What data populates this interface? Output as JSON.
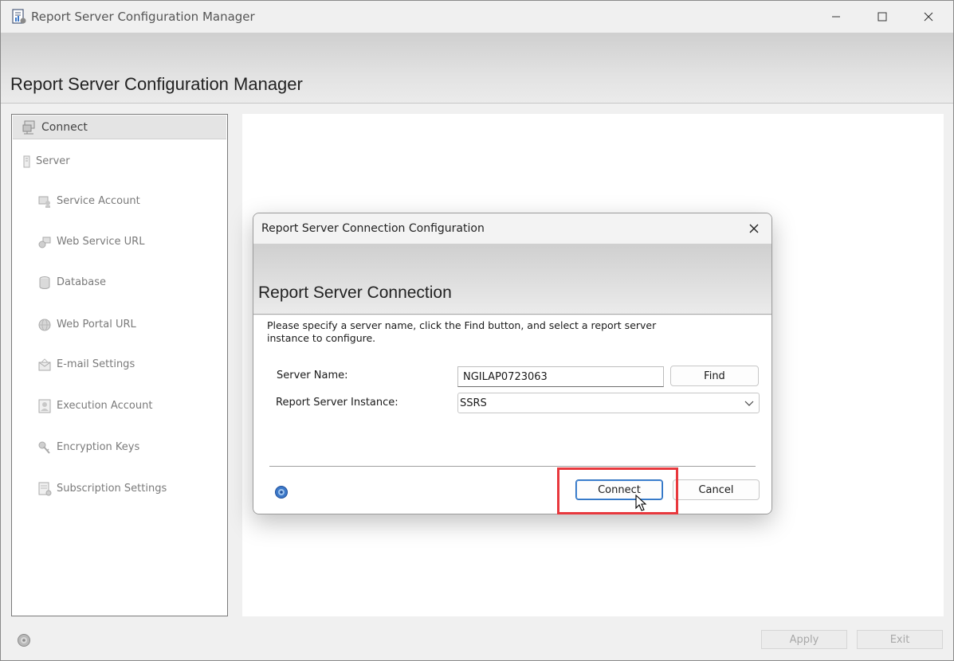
{
  "window": {
    "title": "Report Server Configuration Manager",
    "banner_title": "Report Server Configuration Manager"
  },
  "nav": {
    "connect_label": "Connect",
    "items": [
      {
        "label": "Server",
        "icon": "server-icon"
      },
      {
        "label": "Service Account",
        "icon": "service-account-icon"
      },
      {
        "label": "Web Service URL",
        "icon": "web-service-url-icon"
      },
      {
        "label": "Database",
        "icon": "database-icon"
      },
      {
        "label": "Web Portal URL",
        "icon": "globe-icon"
      },
      {
        "label": "E-mail Settings",
        "icon": "email-icon"
      },
      {
        "label": "Execution Account",
        "icon": "execution-account-icon"
      },
      {
        "label": "Encryption Keys",
        "icon": "key-icon"
      },
      {
        "label": "Subscription Settings",
        "icon": "subscription-icon"
      }
    ]
  },
  "footer": {
    "apply_label": "Apply",
    "exit_label": "Exit"
  },
  "dialog": {
    "title": "Report Server Connection Configuration",
    "heading": "Report Server Connection",
    "description": "Please specify a server name, click the Find button, and select a report server instance to configure.",
    "server_name_label": "Server Name:",
    "server_name_value": "NGILAP0723063",
    "find_label": "Find",
    "instance_label": "Report Server Instance:",
    "instance_value": "SSRS",
    "connect_label": "Connect",
    "cancel_label": "Cancel"
  },
  "colors": {
    "highlight": "#e8383d",
    "focus_border": "#2a6fbf"
  }
}
